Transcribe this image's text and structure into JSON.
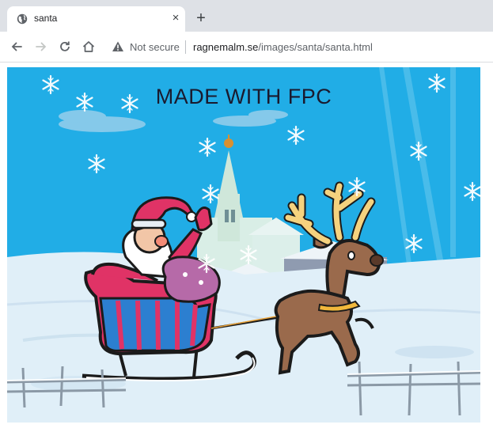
{
  "browser": {
    "tab": {
      "title": "santa",
      "favicon": "globe-icon",
      "close_glyph": "×"
    },
    "new_tab_glyph": "+",
    "security_label": "Not secure",
    "url": {
      "domain": "ragnemalm.se",
      "path": "/images/santa/santa.html"
    }
  },
  "page": {
    "headline": "MADE WITH FPC",
    "colors": {
      "sky": "#1eaee7",
      "snow": "#dfeff8",
      "sleigh": "#e03366",
      "reindeer": "#9a6a4c",
      "antlers": "#f5d27e"
    }
  }
}
